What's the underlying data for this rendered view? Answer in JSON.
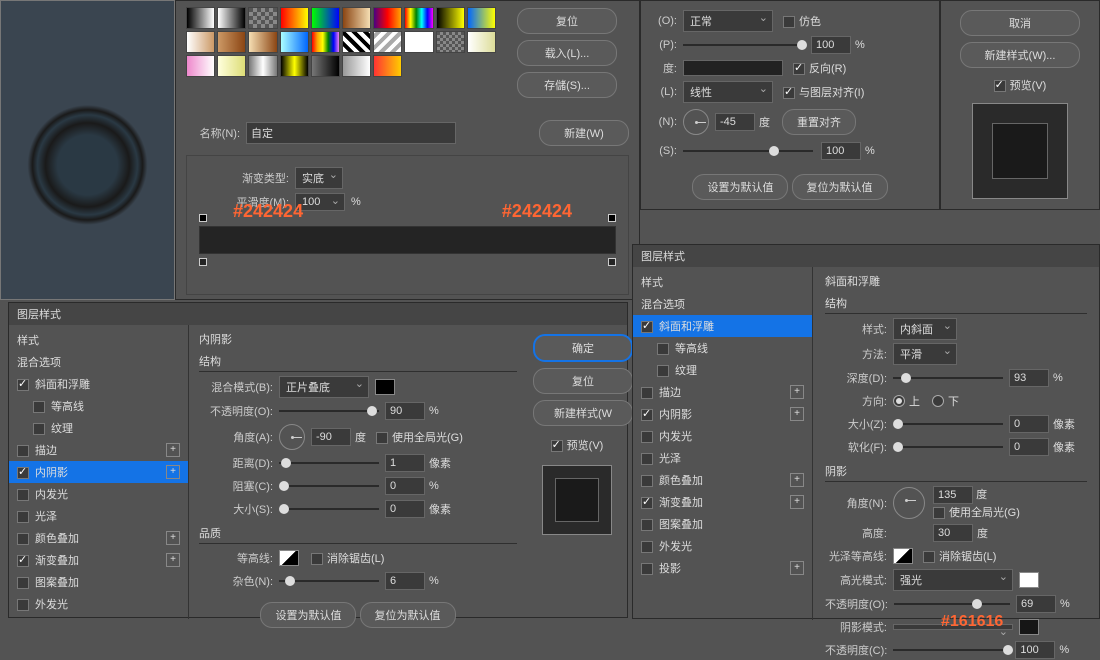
{
  "buttons": {
    "reset": "复位",
    "load": "载入(L)...",
    "save": "存儲(S)...",
    "new": "新建(W)",
    "ok": "确定",
    "cancel": "取消",
    "newstyle": "新建样式(W)...",
    "newstyle2": "新建样式(W",
    "default_set": "设置为默认值",
    "default_reset": "复位为默认值",
    "reset_align": "重置对齐"
  },
  "labels": {
    "name": "名称(N):",
    "custom": "自定",
    "grad_type": "渐变类型:",
    "solid": "实底",
    "smooth": "平滑度(M):",
    "percent": "%",
    "preview": "预览(V)",
    "dither": "仿色",
    "reverse": "反向(R)",
    "align_layer": "与图层对齐(I)",
    "degree": "度",
    "pixel": "像素"
  },
  "hex1": "#242424",
  "hex2": "#242424",
  "hex3": "#161616",
  "gradopts": {
    "mode_l": "(O):",
    "mode_v": "正常",
    "opa_l": "(P):",
    "opa_v": "100",
    "grad_l": "度:",
    "style_l": "(L):",
    "style_v": "线性",
    "angle_l": "(N):",
    "angle_v": "-45",
    "scale_l": "(S):",
    "scale_v": "100"
  },
  "smooth_v": "100",
  "dialogs": {
    "layer_style": "图层样式"
  },
  "styles_header": "样式",
  "blend_opts": "混合选项",
  "styles": {
    "bevel": "斜面和浮雕",
    "contour": "等高线",
    "texture": "纹理",
    "stroke": "描边",
    "inner_shadow": "内阴影",
    "inner_glow": "内发光",
    "satin": "光泽",
    "color_overlay": "颜色叠加",
    "grad_overlay": "渐变叠加",
    "pattern_overlay": "图案叠加",
    "outer_glow": "外发光",
    "drop_shadow": "投影"
  },
  "inner_shadow_panel": {
    "title": "内阴影",
    "struct": "结构",
    "blend_l": "混合模式(B):",
    "blend_v": "正片叠底",
    "opa_l": "不透明度(O):",
    "opa_v": "90",
    "angle_l": "角度(A):",
    "angle_v": "-90",
    "global": "使用全局光(G)",
    "dist_l": "距离(D):",
    "dist_v": "1",
    "choke_l": "阻塞(C):",
    "choke_v": "0",
    "size_l": "大小(S):",
    "size_v": "0",
    "quality": "品质",
    "contour_l": "等高线:",
    "anti": "消除锯齿(L)",
    "noise_l": "杂色(N):",
    "noise_v": "6"
  },
  "bevel_panel": {
    "title": "斜面和浮雕",
    "struct": "结构",
    "style_l": "样式:",
    "style_v": "内斜面",
    "tech_l": "方法:",
    "tech_v": "平滑",
    "depth_l": "深度(D):",
    "depth_v": "93",
    "dir_l": "方向:",
    "up": "上",
    "down": "下",
    "size_l": "大小(Z):",
    "size_v": "0",
    "soften_l": "软化(F):",
    "soften_v": "0",
    "shading": "阴影",
    "angle_l": "角度(N):",
    "angle_v": "135",
    "global": "使用全局光(G)",
    "alt_l": "高度:",
    "alt_v": "30",
    "gloss_l": "光泽等高线:",
    "anti": "消除锯齿(L)",
    "hmode_l": "高光模式:",
    "hmode_v": "强光",
    "hopa_l": "不透明度(O):",
    "hopa_v": "69",
    "smode_l": "阴影模式:",
    "sopa_l": "不透明度(C):",
    "sopa_v": "100"
  }
}
